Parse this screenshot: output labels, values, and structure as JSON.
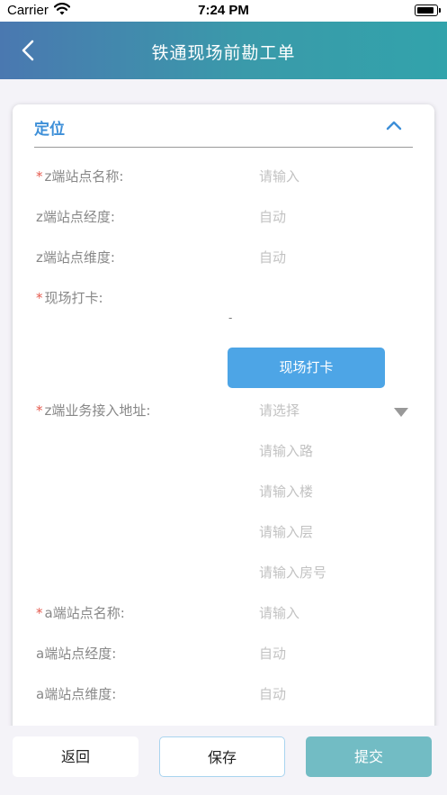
{
  "status_bar": {
    "carrier": "Carrier",
    "time": "7:24 PM"
  },
  "nav": {
    "title": "铁通现场前勘工单"
  },
  "section": {
    "title": "定位"
  },
  "required_mark": "*",
  "rows": {
    "z_site_name": {
      "label": "z端站点名称:",
      "placeholder": "请输入"
    },
    "z_site_lng": {
      "label": "z端站点经度:",
      "value": "自动"
    },
    "z_site_lat": {
      "label": "z端站点维度:",
      "value": "自动"
    },
    "site_checkin": {
      "label": "现场打卡:",
      "dash": "-",
      "button": "现场打卡"
    },
    "z_address": {
      "label": "z端业务接入地址:",
      "select_placeholder": "请选择",
      "road_placeholder": "请输入路",
      "building_placeholder": "请输入楼",
      "floor_placeholder": "请输入层",
      "room_placeholder": "请输入房号"
    },
    "a_site_name": {
      "label": "a端站点名称:",
      "placeholder": "请输入"
    },
    "a_site_lng": {
      "label": "a端站点经度:",
      "value": "自动"
    },
    "a_site_lat": {
      "label": "a端站点维度:",
      "value": "自动"
    }
  },
  "bottom": {
    "back": "返回",
    "save": "保存",
    "submit": "提交"
  },
  "colors": {
    "accent": "#3d8fd8",
    "required": "#e55a4e",
    "primary_button": "#4da5e6",
    "submit_button": "#72bcc4"
  }
}
